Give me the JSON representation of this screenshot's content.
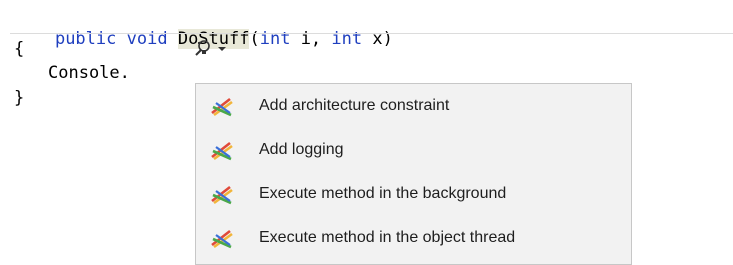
{
  "code": {
    "line1": {
      "kw1": "public",
      "kw2": "void",
      "name": "DoStuff",
      "open": "(",
      "kw3": "int",
      "p1": " i, ",
      "kw4": "int",
      "p2": " x)"
    },
    "line2": "{",
    "line3_visible": "Console.",
    "line4": "}"
  },
  "quick_actions": {
    "icon": "screwdriver-lightbulb-icon",
    "dropdown_icon": "chevron-down-icon",
    "items": [
      {
        "label": "Add architecture constraint",
        "icon": "postsharp-icon"
      },
      {
        "label": "Add logging",
        "icon": "postsharp-icon"
      },
      {
        "label": "Execute method in the background",
        "icon": "postsharp-icon"
      },
      {
        "label": "Execute method in the object thread",
        "icon": "postsharp-icon"
      }
    ]
  },
  "colors": {
    "keyword": "#1f3fbf",
    "menu_bg": "#f2f2f2",
    "menu_border": "#c7c7c7"
  }
}
